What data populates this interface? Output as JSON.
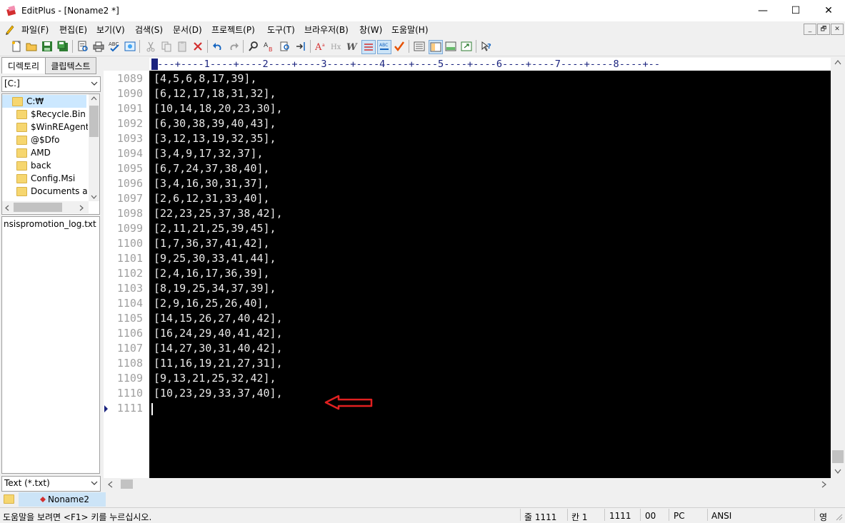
{
  "window": {
    "title": "EditPlus - [Noname2 *]",
    "minimize": "—",
    "maximize": "☐",
    "close": "✕"
  },
  "menu": [
    "파일(F)",
    "편집(E)",
    "보기(V)",
    "검색(S)",
    "문서(D)",
    "프로젝트(P)",
    "도구(T)",
    "브라우저(B)",
    "창(W)",
    "도움말(H)"
  ],
  "mdi_buttons": [
    "_",
    "🗗",
    "✕"
  ],
  "left_panel": {
    "tab_directory": "디렉토리",
    "tab_cliptext": "클립텍스트",
    "drive": "[C:]",
    "tree": [
      "C:₩",
      "$Recycle.Bin",
      "$WinREAgent",
      "@$Dfo",
      "AMD",
      "back",
      "Config.Msi",
      "Documents an"
    ],
    "files": [
      "nsispromotion_log.txt"
    ],
    "filetype": "Text (*.txt)"
  },
  "editor": {
    "ruler": "----+----1----+----2----+----3----+----4----+----5----+----6----+----7----+----8----+--",
    "line_numbers": [
      "1089",
      "1090",
      "1091",
      "1092",
      "1093",
      "1094",
      "1095",
      "1096",
      "1097",
      "1098",
      "1099",
      "1100",
      "1101",
      "1102",
      "1103",
      "1104",
      "1105",
      "1106",
      "1107",
      "1108",
      "1109",
      "1110",
      "1111"
    ],
    "lines": [
      "[4,5,6,8,17,39],",
      "[6,12,17,18,31,32],",
      "[10,14,18,20,23,30],",
      "[6,30,38,39,40,43],",
      "[3,12,13,19,32,35],",
      "[3,4,9,17,32,37],",
      "[6,7,24,37,38,40],",
      "[3,4,16,30,31,37],",
      "[2,6,12,31,33,40],",
      "[22,23,25,37,38,42],",
      "[2,11,21,25,39,45],",
      "[1,7,36,37,41,42],",
      "[9,25,30,33,41,44],",
      "[2,4,16,17,36,39],",
      "[8,19,25,34,37,39],",
      "[2,9,16,25,26,40],",
      "[14,15,26,27,40,42],",
      "[16,24,29,40,41,42],",
      "[14,27,30,31,40,42],",
      "[11,16,19,21,27,31],",
      "[9,13,21,25,32,42],",
      "[10,23,29,33,37,40],",
      ""
    ],
    "annotation_color": "#e02020"
  },
  "doc_tab": "Noname2",
  "status": {
    "help": "도움말을 보려면 <F1> 키를 누르십시오.",
    "line": "줄 1111",
    "col": "칸 1",
    "count": "1111",
    "num": "00",
    "eol": "PC",
    "encoding": "ANSI",
    "ime": "영"
  },
  "colors": {
    "editor_bg": "#000000",
    "editor_fg": "#e8e8e8",
    "line_number": "#a0a0a0",
    "ruler": "#1a237e",
    "selected_tab": "#cce4f7"
  }
}
